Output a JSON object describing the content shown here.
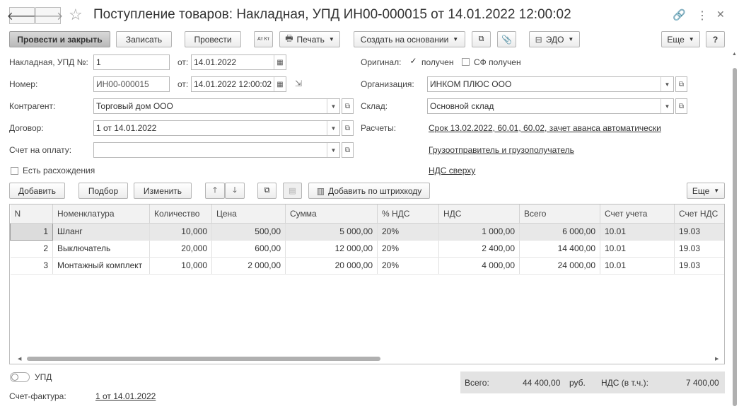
{
  "window": {
    "title": "Поступление товаров: Накладная, УПД ИН00-000015 от 14.01.2022 12:00:02",
    "back_icon": "arrow-left",
    "forward_icon": "arrow-right",
    "favorite_icon": "star",
    "link_icon": "chain",
    "more_icon": "vertical-dots",
    "close_icon": "cross"
  },
  "toolbar": {
    "post_close": "Провести и закрыть",
    "save": "Записать",
    "post": "Провести",
    "dtkt": "Ат Кт",
    "print": "Печать",
    "create_based": "Создать на основании",
    "edo": "ЭДО",
    "more": "Еще",
    "help": "?"
  },
  "form": {
    "invoice_label": "Накладная, УПД №:",
    "invoice_value": "1",
    "from_label": "от:",
    "invoice_date": "14.01.2022",
    "number_label": "Номер:",
    "number_value": "ИН00-000015",
    "number_date": "14.01.2022 12:00:02",
    "contractor_label": "Контрагент:",
    "contractor_value": "Торговый дом ООО",
    "contract_label": "Договор:",
    "contract_value": "1 от 14.01.2022",
    "invoice_pay_label": "Счет на оплату:",
    "invoice_pay_value": "",
    "discrepancy_label": "Есть расхождения",
    "original_label": "Оригинал:",
    "received_label": "получен",
    "sf_received_label": "СФ получен",
    "org_label": "Организация:",
    "org_value": "ИНКОМ ПЛЮС ООО",
    "warehouse_label": "Склад:",
    "warehouse_value": "Основной склад",
    "settlements_label": "Расчеты:",
    "settlements_link": "Срок 13.02.2022, 60.01, 60.02, зачет аванса автоматически",
    "shipper_link": "Грузоотправитель и грузополучатель",
    "vat_link": "НДС сверху"
  },
  "table_toolbar": {
    "add": "Добавить",
    "pick": "Подбор",
    "change": "Изменить",
    "add_barcode": "Добавить по штрихкоду",
    "more": "Еще"
  },
  "table": {
    "columns": [
      "N",
      "Номенклатура",
      "Количество",
      "Цена",
      "Сумма",
      "% НДС",
      "НДС",
      "Всего",
      "Счет учета",
      "Счет НДС"
    ],
    "rows": [
      [
        "1",
        "Шланг",
        "10,000",
        "500,00",
        "5 000,00",
        "20%",
        "1 000,00",
        "6 000,00",
        "10.01",
        "19.03"
      ],
      [
        "2",
        "Выключатель",
        "20,000",
        "600,00",
        "12 000,00",
        "20%",
        "2 400,00",
        "14 400,00",
        "10.01",
        "19.03"
      ],
      [
        "3",
        "Монтажный комплект",
        "10,000",
        "2 000,00",
        "20 000,00",
        "20%",
        "4 000,00",
        "24 000,00",
        "10.01",
        "19.03"
      ]
    ]
  },
  "footer": {
    "upd_label": "УПД",
    "invoice_label": "Счет-фактура:",
    "invoice_link": "1 от 14.01.2022",
    "total_label": "Всего:",
    "total_value": "44 400,00",
    "currency": "руб.",
    "vat_label": "НДС (в т.ч.):",
    "vat_value": "7 400,00"
  }
}
